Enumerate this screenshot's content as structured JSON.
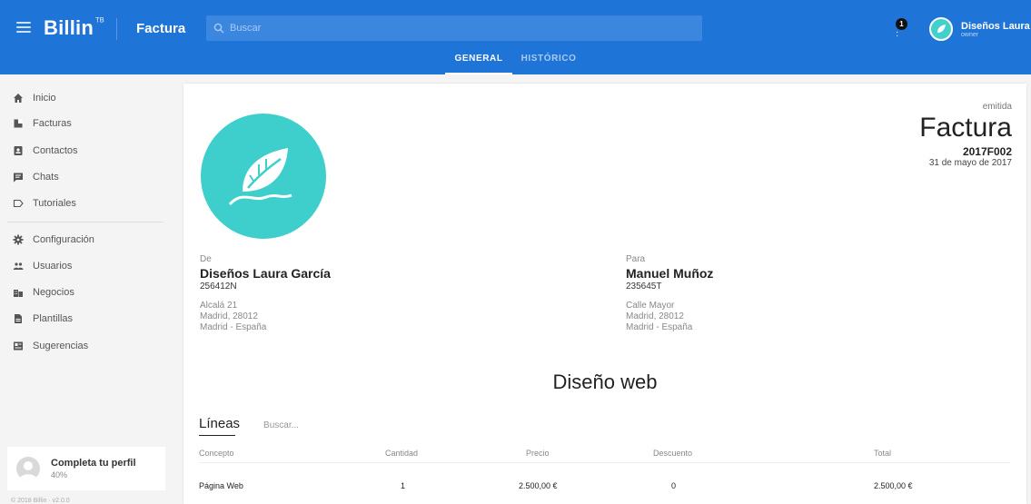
{
  "topbar": {
    "logo": "Billin",
    "logo_mark": "ᵀᴮ",
    "section": "Factura",
    "search_placeholder": "Buscar",
    "notifications_count": "1",
    "user_name": "Diseños Laura García",
    "user_role": "owner"
  },
  "tabs": [
    {
      "label": "GENERAL",
      "active": true
    },
    {
      "label": "HISTÓRICO",
      "active": false
    }
  ],
  "sidebar": {
    "items": [
      {
        "label": "Inicio",
        "icon": "home-icon"
      },
      {
        "label": "Facturas",
        "icon": "invoice-icon"
      },
      {
        "label": "Contactos",
        "icon": "contacts-icon"
      },
      {
        "label": "Chats",
        "icon": "chat-icon"
      },
      {
        "label": "Tutoriales",
        "icon": "tutorial-icon"
      }
    ],
    "items2": [
      {
        "label": "Configuración",
        "icon": "gear-icon"
      },
      {
        "label": "Usuarios",
        "icon": "users-icon"
      },
      {
        "label": "Negocios",
        "icon": "business-icon"
      },
      {
        "label": "Plantillas",
        "icon": "template-icon"
      },
      {
        "label": "Sugerencias",
        "icon": "suggestion-icon"
      }
    ],
    "profile_title": "Completa tu perfil",
    "profile_pct": "40%",
    "copyright": "© 2018 Billin · v2.0.0"
  },
  "invoice": {
    "status": "emitida",
    "type": "Factura",
    "number": "2017F002",
    "date": "31 de mayo de 2017",
    "from": {
      "label": "De",
      "name": "Diseños Laura García",
      "id": "256412N",
      "addr1": "Alcalá 21",
      "addr2": "Madrid, 28012",
      "addr3": "Madrid - España"
    },
    "to": {
      "label": "Para",
      "name": "Manuel Muñoz",
      "id": "235645T",
      "addr1": "Calle Mayor",
      "addr2": "Madrid, 28012",
      "addr3": "Madrid - España"
    },
    "project": "Diseño web",
    "lines_title": "Líneas",
    "lines_search_placeholder": "Buscar...",
    "columns": {
      "concept": "Concepto",
      "quantity": "Cantidad",
      "price": "Precio",
      "discount": "Descuento",
      "total": "Total"
    },
    "rows": [
      {
        "concept": "Página Web",
        "quantity": "1",
        "price": "2.500,00 €",
        "discount": "0",
        "total": "2.500,00 €"
      }
    ]
  },
  "colors": {
    "primary": "#1f74d8",
    "logo_teal": "#3ecfcc"
  }
}
